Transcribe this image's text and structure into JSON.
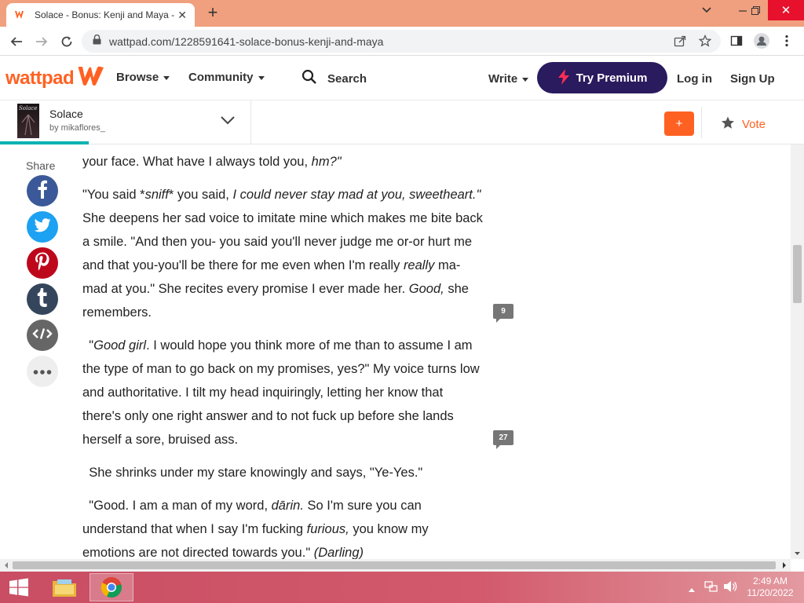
{
  "browser": {
    "tab_title": "Solace - Bonus: Kenji and Maya -",
    "url": "wattpad.com/1228591641-solace-bonus-kenji-and-maya"
  },
  "header": {
    "logo": "wattpad",
    "browse": "Browse",
    "community": "Community",
    "search": "Search",
    "write": "Write",
    "premium": "Try Premium",
    "login": "Log in",
    "signup": "Sign Up"
  },
  "story": {
    "cover_text": "Solace",
    "title": "Solace",
    "author": "by mikaflores_",
    "progress_percent": 11,
    "add_label": "+",
    "vote_label": "Vote"
  },
  "share": {
    "label": "Share"
  },
  "paragraphs": [
    {
      "lines": [
        [
          {
            "t": "your face. What have I always told you, "
          },
          {
            "t": "hm?\"",
            "i": true
          }
        ]
      ]
    },
    {
      "lines": [
        [
          {
            "t": "\"You said *"
          },
          {
            "t": "sniff",
            "i": true
          },
          {
            "t": "* you said, "
          },
          {
            "t": "I could never stay mad at you, sweetheart.\"",
            "i": true
          }
        ],
        [
          {
            "t": "She deepens her sad voice to imitate mine which makes me bite back"
          }
        ],
        [
          {
            "t": "a smile. \"And then you- you said you'll never judge me or-or hurt me"
          }
        ],
        [
          {
            "t": "and that you-you'll be there for me even when I'm really "
          },
          {
            "t": "really",
            "i": true
          },
          {
            "t": " ma-"
          }
        ],
        [
          {
            "t": "mad at you.\" She recites every promise I ever made her. "
          },
          {
            "t": "Good,",
            "i": true
          },
          {
            "t": " she"
          }
        ],
        [
          {
            "t": "remembers."
          }
        ]
      ]
    },
    {
      "lines": [
        [
          {
            "t": " \""
          },
          {
            "t": "Good girl",
            "i": true
          },
          {
            "t": ". I would hope you think more of me than to assume I am"
          }
        ],
        [
          {
            "t": "the type of man to go back on my promises, yes?\" My voice turns low"
          }
        ],
        [
          {
            "t": "and authoritative. I tilt my head inquiringly, letting her know that"
          }
        ],
        [
          {
            "t": "there's only one right answer and to not fuck up before she lands"
          }
        ],
        [
          {
            "t": "herself a sore, bruised ass."
          }
        ]
      ]
    },
    {
      "lines": [
        [
          {
            "t": " She shrinks under my stare knowingly and says, \"Ye-Yes.\""
          }
        ]
      ]
    },
    {
      "lines": [
        [
          {
            "t": " \"Good. I am a man of my word, "
          },
          {
            "t": "dārin.",
            "i": true
          },
          {
            "t": " So I'm sure you can"
          }
        ],
        [
          {
            "t": "understand that when I say I'm fucking "
          },
          {
            "t": "furious,",
            "i": true
          },
          {
            "t": " you know my"
          }
        ],
        [
          {
            "t": "emotions are not directed towards you.\" "
          },
          {
            "t": "(Darling)",
            "i": true
          }
        ]
      ]
    }
  ],
  "comments": [
    {
      "count": "9"
    },
    {
      "count": "27"
    }
  ],
  "taskbar": {
    "time": "2:49 AM",
    "date": "11/20/2022"
  },
  "colors": {
    "brand": "#ff6122",
    "premium": "#2a1a5e",
    "progress": "#00b2b2"
  }
}
